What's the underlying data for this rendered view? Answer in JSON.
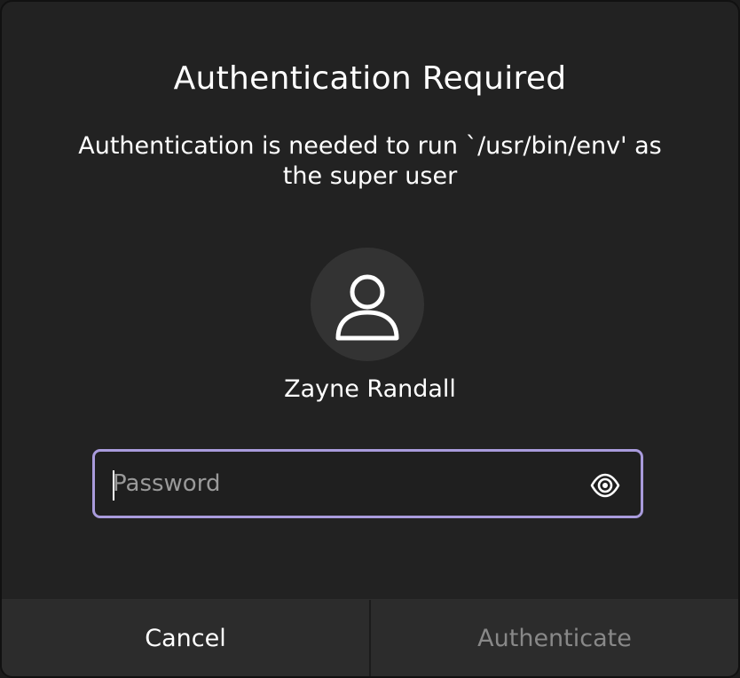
{
  "dialog": {
    "title": "Authentication Required",
    "message": "Authentication is needed to run `/usr/bin/env' as the super user",
    "user": {
      "avatar_icon": "user-icon",
      "name": "Zayne Randall"
    },
    "password": {
      "placeholder": "Password",
      "value": "",
      "reveal_icon": "eye-icon",
      "focused": true,
      "focus_color": "#a99bdc"
    },
    "buttons": {
      "cancel_label": "Cancel",
      "authenticate_label": "Authenticate",
      "authenticate_enabled": false
    }
  }
}
